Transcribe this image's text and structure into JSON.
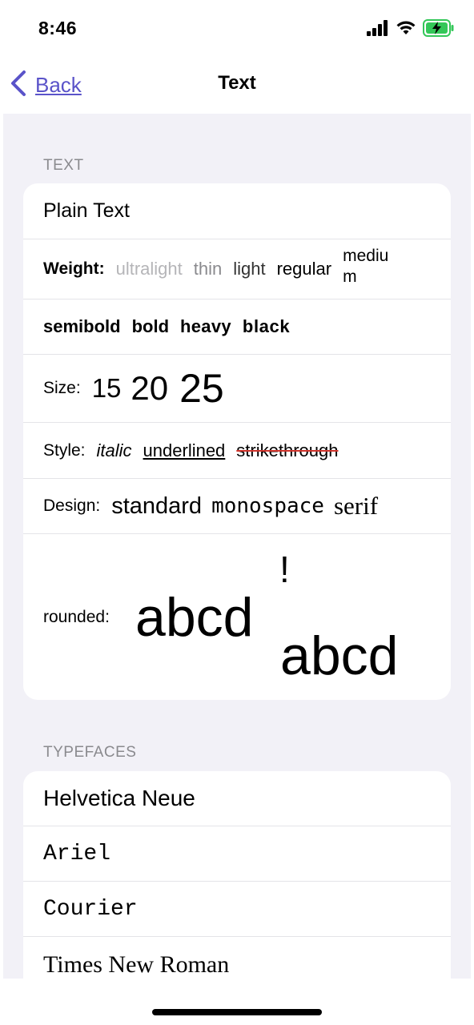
{
  "status_bar": {
    "time": "8:46"
  },
  "nav": {
    "back_label": "Back",
    "title": "Text"
  },
  "text_section": {
    "header": "TEXT",
    "plain_text": "Plain Text",
    "weight": {
      "label": "Weight:",
      "ultralight": "ultralight",
      "thin": "thin",
      "light": "light",
      "regular": "regular",
      "medium_line1": "mediu",
      "medium_line2": "m",
      "semibold": "semibold",
      "bold": "bold",
      "heavy": "heavy",
      "black": "black"
    },
    "size": {
      "label": "Size:",
      "s15": "15",
      "s20": "20",
      "s25": "25"
    },
    "style": {
      "label": "Style:",
      "italic": "italic",
      "underlined": "underlined",
      "strikethrough": "strikethrough"
    },
    "design": {
      "label": "Design:",
      "standard": "standard",
      "monospace": "monospace",
      "serif": "serif"
    },
    "rounded": {
      "label": "rounded:",
      "large": "abcd",
      "exclaim": "!",
      "small": "abcd"
    }
  },
  "typefaces_section": {
    "header": "TYPEFACES",
    "items": [
      "Helvetica Neue",
      "Ariel",
      "Courier",
      "Times New Roman"
    ]
  },
  "colors": {
    "accent": "#5a53c9",
    "strike": "#d0342c",
    "background": "#f2f1f7"
  }
}
